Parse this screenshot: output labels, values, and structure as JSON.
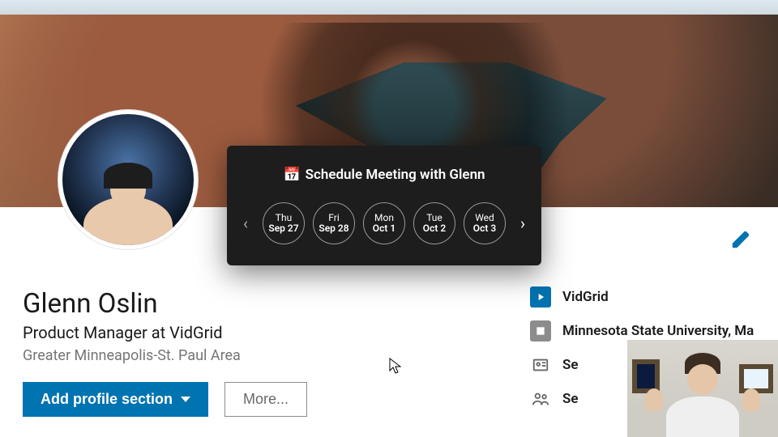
{
  "profile": {
    "name": "Glenn Oslin",
    "headline": "Product Manager at VidGrid",
    "location": "Greater Minneapolis-St. Paul Area"
  },
  "buttons": {
    "add_section": "Add profile section",
    "more": "More..."
  },
  "right": {
    "company": "VidGrid",
    "school": "Minnesota State University, Ma",
    "see_contacts": "Se",
    "see_connections": "Se"
  },
  "popover": {
    "title": "Schedule Meeting with Glenn",
    "dates": [
      {
        "dow": "Thu",
        "md": "Sep 27"
      },
      {
        "dow": "Fri",
        "md": "Sep 28"
      },
      {
        "dow": "Mon",
        "md": "Oct 1"
      },
      {
        "dow": "Tue",
        "md": "Oct 2"
      },
      {
        "dow": "Wed",
        "md": "Oct 3"
      }
    ]
  },
  "colors": {
    "primary": "#0073b1"
  }
}
